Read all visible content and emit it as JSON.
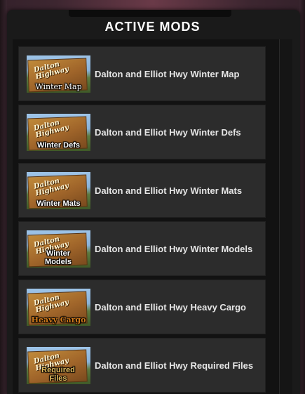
{
  "panel": {
    "title": "ACTIVE MODS"
  },
  "mods": [
    {
      "name": "Dalton and Elliot Hwy Winter Map",
      "thumb_caption": "Winter Map",
      "thumb_sign": "Dalton Highway",
      "caption_style": "serif"
    },
    {
      "name": "Dalton and Elliot Hwy Winter Defs",
      "thumb_caption": "Winter Defs",
      "thumb_sign": "Dalton Highway",
      "caption_style": "sans"
    },
    {
      "name": "Dalton and Elliot Hwy Winter Mats",
      "thumb_caption": "Winter Mats",
      "thumb_sign": "Dalton Highway",
      "caption_style": "sans"
    },
    {
      "name": "Dalton and Elliot Hwy Winter Models",
      "thumb_caption": "Winter Models",
      "thumb_sign": "Dalton Highway",
      "caption_style": "sans"
    },
    {
      "name": "Dalton and Elliot Hwy Heavy Cargo",
      "thumb_caption": "Heavy Cargo",
      "thumb_sign": "Dalton Highway",
      "caption_style": "orange"
    },
    {
      "name": "Dalton and Elliot Hwy Required Files",
      "thumb_caption": "Required Files",
      "thumb_sign": "Dalton Highway",
      "caption_style": "sans"
    }
  ],
  "colors": {
    "item_bg": "#2c2c2c",
    "panel_bg": "#1a1a1a",
    "text": "#e6e6e6",
    "title": "#ffffff"
  }
}
